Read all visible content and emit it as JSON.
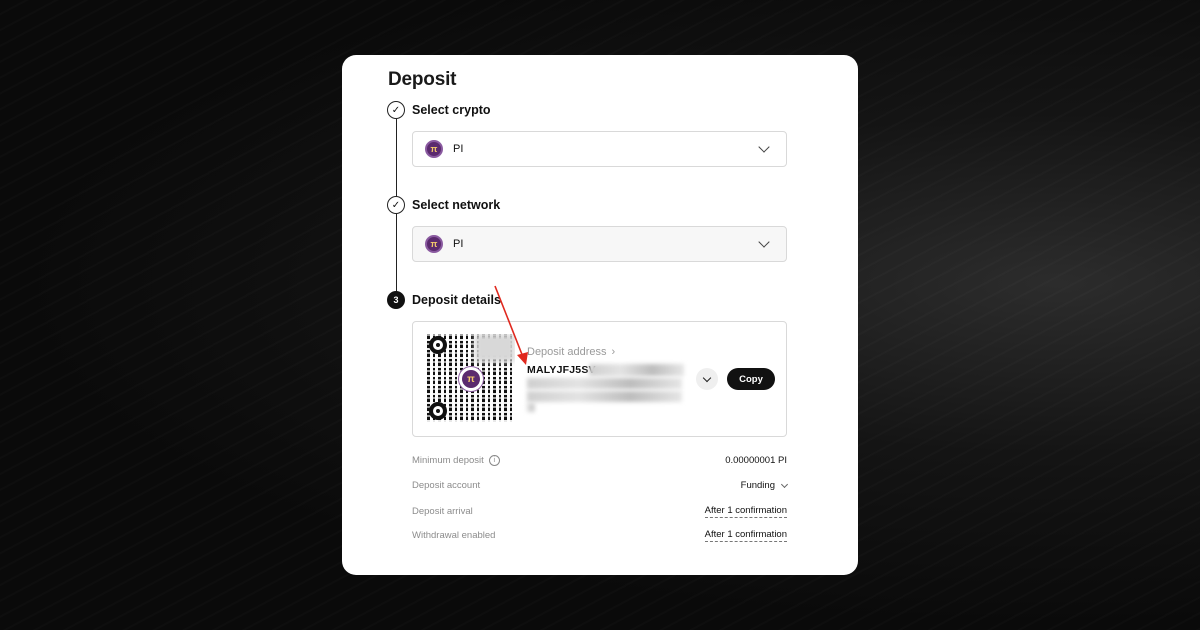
{
  "page": {
    "title": "Deposit"
  },
  "steps": [
    {
      "number": "✓",
      "label": "Select crypto",
      "status": "done"
    },
    {
      "number": "✓",
      "label": "Select network",
      "status": "done"
    },
    {
      "number": "3",
      "label": "Deposit details",
      "status": "active"
    }
  ],
  "crypto_select": {
    "coin_icon": "pi-coin-icon",
    "value": "PI"
  },
  "network_select": {
    "coin_icon": "pi-coin-icon",
    "value": "PI"
  },
  "deposit": {
    "address_label": "Deposit address",
    "address_visible": "MALYJFJ5SV",
    "copy_label": "Copy"
  },
  "info": [
    {
      "key": "Minimum deposit",
      "value": "0.00000001 PI"
    },
    {
      "key": "Deposit account",
      "value": "Funding"
    },
    {
      "key": "Deposit arrival",
      "value": "After 1 confirmation"
    },
    {
      "key": "Withdrawal enabled",
      "value": "After 1 confirmation"
    }
  ],
  "colors": {
    "accent": "#111111",
    "annotation_arrow": "#e0281e",
    "coin_purple": "#5b2a6e"
  }
}
